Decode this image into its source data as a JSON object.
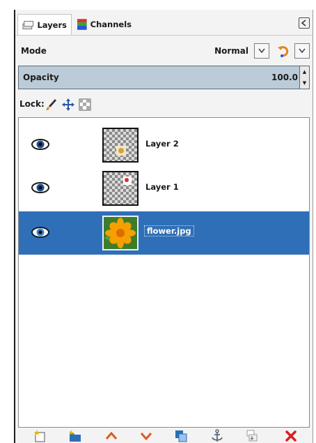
{
  "tabs": [
    {
      "label": "Layers",
      "icon": "layers-icon",
      "active": true
    },
    {
      "label": "Channels",
      "icon": "channels-icon",
      "active": false
    }
  ],
  "tab_menu_icon": "tab-menu-icon",
  "mode": {
    "label": "Mode",
    "value": "Normal"
  },
  "opacity": {
    "label": "Opacity",
    "value": "100.0"
  },
  "lock": {
    "label": "Lock:",
    "icons": [
      "brush-lock-icon",
      "move-lock-icon",
      "alpha-lock-icon"
    ]
  },
  "layers": [
    {
      "name": "Layer 2",
      "visible": true,
      "selected": false,
      "thumbnail": "checkerboard"
    },
    {
      "name": "Layer 1",
      "visible": true,
      "selected": false,
      "thumbnail": "checkerboard"
    },
    {
      "name": "flower.jpg",
      "visible": true,
      "selected": true,
      "thumbnail": "flower"
    }
  ],
  "bottom_actions": [
    "new-layer-icon",
    "new-layer-group-icon",
    "raise-layer-icon",
    "lower-layer-icon",
    "duplicate-layer-icon",
    "anchor-layer-icon",
    "merge-down-icon",
    "delete-layer-icon"
  ],
  "colors": {
    "selection": "#2f6fb7",
    "opacity_bar": "#bccbd8",
    "accent_orange": "#e8821e",
    "delete_red": "#d91f1f"
  }
}
